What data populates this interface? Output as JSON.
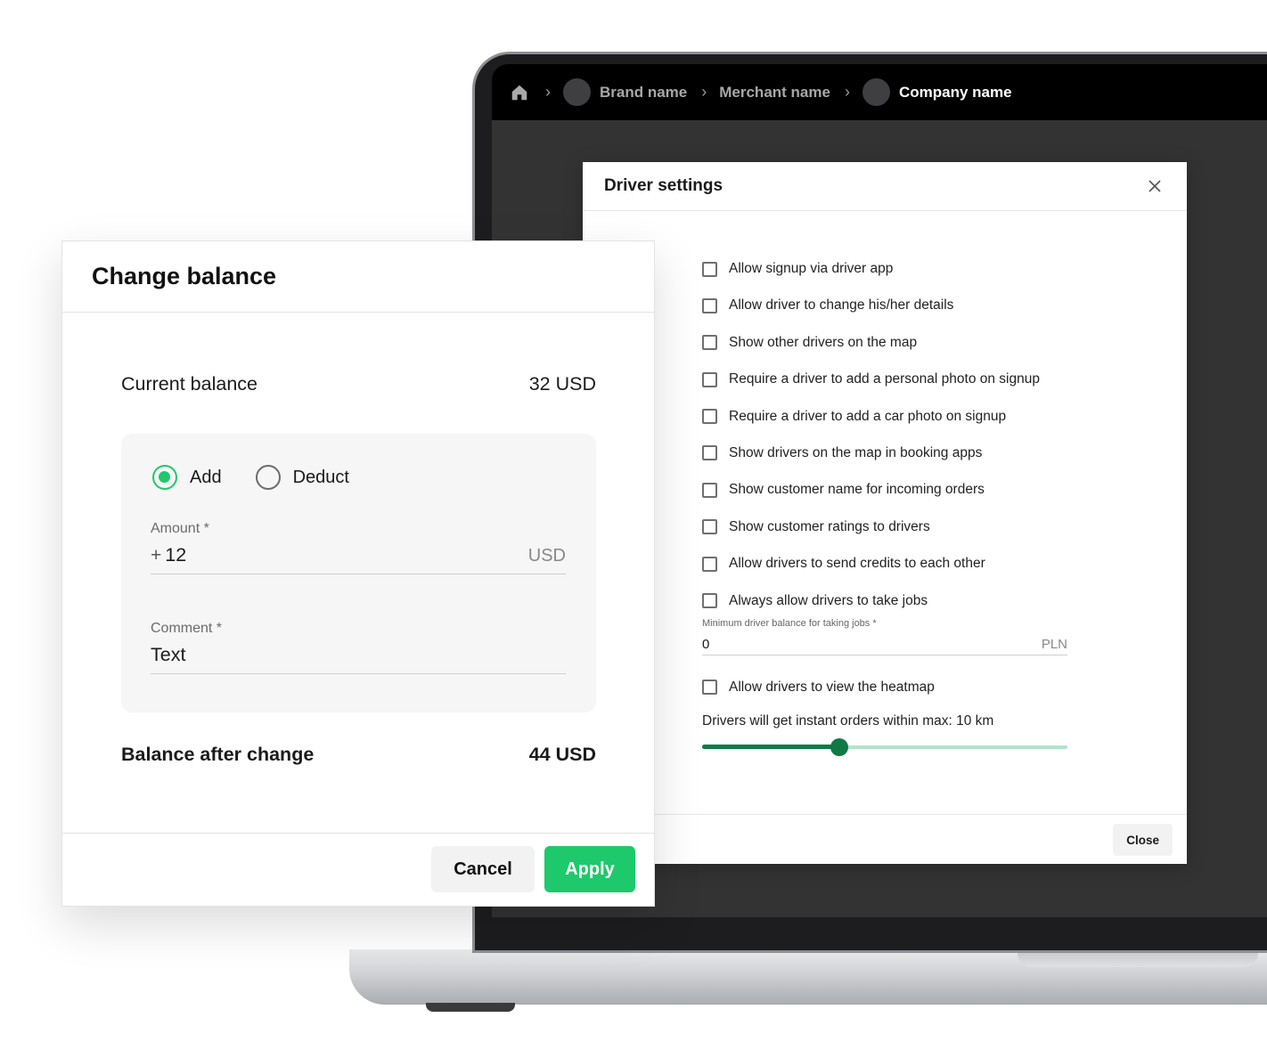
{
  "breadcrumb": {
    "items": [
      {
        "label": "Brand name",
        "active": false
      },
      {
        "label": "Merchant name",
        "active": false
      },
      {
        "label": "Company name",
        "active": true
      }
    ]
  },
  "driver_settings": {
    "title": "Driver settings",
    "options": [
      {
        "label": "Allow signup via driver app",
        "checked": false
      },
      {
        "label": "Allow driver to change his/her details",
        "checked": false
      },
      {
        "label": "Show other drivers on the map",
        "checked": false
      },
      {
        "label": "Require a driver to add a personal photo on signup",
        "checked": false
      },
      {
        "label": "Require a driver to add a car photo on signup",
        "checked": false
      },
      {
        "label": "Show drivers on the map in booking apps",
        "checked": false
      },
      {
        "label": "Show customer name for incoming orders",
        "checked": false
      },
      {
        "label": "Show customer ratings to drivers",
        "checked": false
      },
      {
        "label": "Allow drivers to send credits to each other",
        "checked": false
      },
      {
        "label": "Always allow drivers to take jobs",
        "checked": false
      }
    ],
    "min_balance": {
      "label": "Minimum driver balance for taking jobs *",
      "value": "0",
      "unit": "PLN"
    },
    "heatmap_option": {
      "label": "Allow drivers to view the heatmap",
      "checked": false
    },
    "slider": {
      "label": "Drivers will get instant orders within max: 10 km",
      "fraction": 0.375
    },
    "close_label": "Close"
  },
  "change_balance": {
    "title": "Change balance",
    "current_label": "Current balance",
    "current_value": "32 USD",
    "operation": {
      "options": [
        {
          "label": "Add",
          "checked": true
        },
        {
          "label": "Deduct",
          "checked": false
        }
      ]
    },
    "amount": {
      "label": "Amount *",
      "prefix": "+",
      "value": "12",
      "unit": "USD"
    },
    "comment": {
      "label": "Comment *",
      "value": "Text"
    },
    "after_label": "Balance after change",
    "after_value": "44 USD",
    "cancel_label": "Cancel",
    "apply_label": "Apply"
  },
  "colors": {
    "accent_green": "#1ec96b",
    "slider_green": "#0f7a46",
    "slider_track": "#b6e3cd",
    "topbar": "#000000",
    "screen_bg": "#333333"
  }
}
